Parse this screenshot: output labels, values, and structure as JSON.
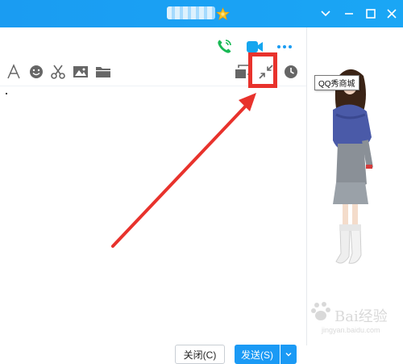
{
  "window": {
    "title": "",
    "star_icon": "star-icon",
    "controls": [
      "chevron-down-icon",
      "minimize-icon",
      "maximize-icon",
      "close-icon"
    ],
    "bar_color": "#1a9cf2"
  },
  "header_actions": [
    "phone-call-icon",
    "video-call-icon",
    "more-icon"
  ],
  "toolbar": {
    "left": [
      "font-icon",
      "emoji-icon",
      "scissors-icon",
      "image-icon",
      "folder-icon"
    ],
    "right": [
      "window-mode-icon",
      "minimize-arrows-icon",
      "history-clock-icon"
    ]
  },
  "tooltip": {
    "qq_show": "QQ秀商城"
  },
  "footer": {
    "close_label": "关闭(C)",
    "send_label": "发送(S)"
  },
  "annotation": {
    "color": "#e8322c"
  },
  "watermark": {
    "text": "Bai经验",
    "sub": "jingyan.baidu.com"
  }
}
